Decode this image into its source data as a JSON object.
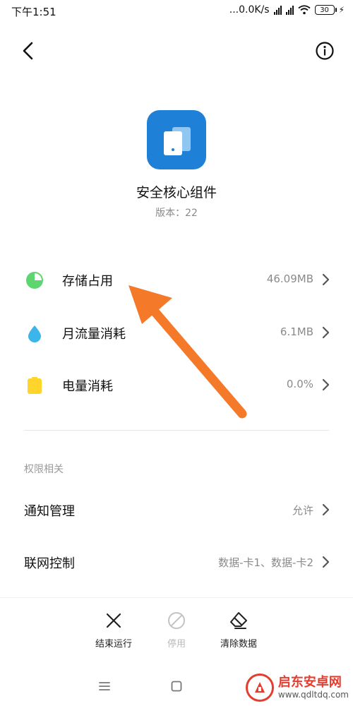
{
  "status_bar": {
    "time": "下午1:51",
    "network_speed": "...0.0K/s",
    "battery": "30"
  },
  "app": {
    "name": "安全核心组件",
    "version_label": "版本：",
    "version_value": "22",
    "icon_color": "#1e80d6"
  },
  "usage_rows": [
    {
      "label": "存储占用",
      "value": "46.09MB",
      "icon": "pie-chart-icon",
      "color": "#5ed66f"
    },
    {
      "label": "月流量消耗",
      "value": "6.1MB",
      "icon": "water-drop-icon",
      "color": "#3bb5ea"
    },
    {
      "label": "电量消耗",
      "value": "0.0%",
      "icon": "battery-icon",
      "color": "#ffd52b"
    }
  ],
  "permissions": {
    "section_title": "权限相关",
    "rows": [
      {
        "label": "通知管理",
        "value": "允许"
      },
      {
        "label": "联网控制",
        "value": "数据-卡1、数据-卡2"
      }
    ]
  },
  "actions": [
    {
      "label": "结束运行",
      "icon": "close-icon",
      "enabled": true
    },
    {
      "label": "停用",
      "icon": "disable-icon",
      "enabled": false
    },
    {
      "label": "清除数据",
      "icon": "eraser-icon",
      "enabled": true
    }
  ],
  "annotation": {
    "arrow_color": "#f47a29"
  },
  "watermark": {
    "title": "启东安卓网",
    "url": "www.qdltdq.com"
  }
}
